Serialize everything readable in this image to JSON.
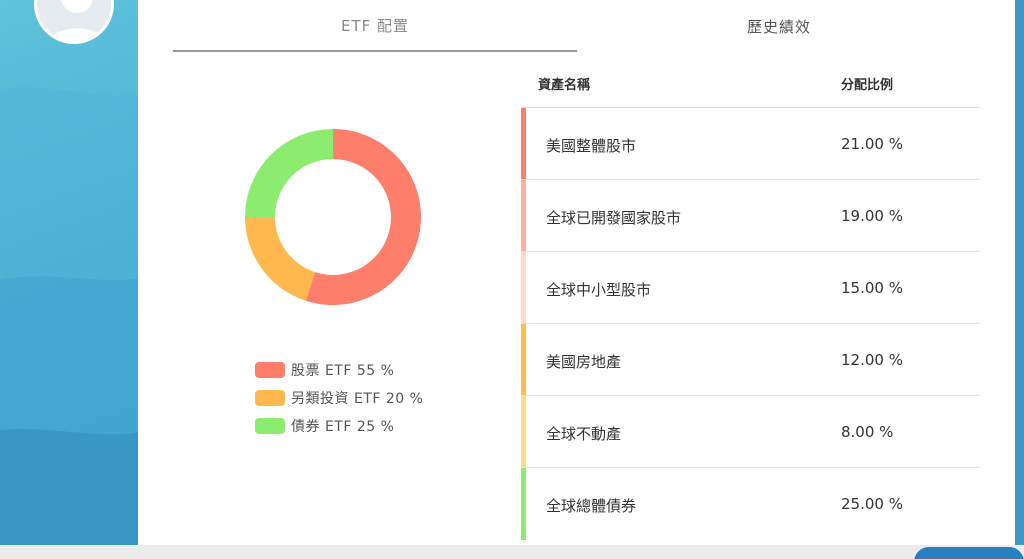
{
  "tabs": [
    {
      "label": "ETF 配置",
      "active": true
    },
    {
      "label": "歷史績效",
      "active": false
    }
  ],
  "chart_data": {
    "type": "pie",
    "variant": "donut",
    "categories": [
      "股票 ETF",
      "另類投資 ETF",
      "債券 ETF"
    ],
    "values": [
      55,
      20,
      25
    ],
    "colors": [
      "#fc7e6b",
      "#ffb84d",
      "#8cec6f"
    ]
  },
  "legend": [
    {
      "label": "股票 ETF 55 %",
      "color": "#fc7e6b"
    },
    {
      "label": "另類投資 ETF 20 %",
      "color": "#ffb84d"
    },
    {
      "label": "債券 ETF 25 %",
      "color": "#8cec6f"
    }
  ],
  "table": {
    "headers": {
      "name": "資產名稱",
      "ratio": "分配比例"
    },
    "rows": [
      {
        "name": "美國整體股市",
        "ratio": "21.00 %",
        "color": "#fc7e6b"
      },
      {
        "name": "全球已開發國家股市",
        "ratio": "19.00 %",
        "color": "#fdb0a4"
      },
      {
        "name": "全球中小型股市",
        "ratio": "15.00 %",
        "color": "#ffd9d2"
      },
      {
        "name": "美國房地產",
        "ratio": "12.00 %",
        "color": "#ffbb4d"
      },
      {
        "name": "全球不動產",
        "ratio": "8.00 %",
        "color": "#ffd98a"
      },
      {
        "name": "全球總體債券",
        "ratio": "25.00 %",
        "color": "#8cec6f"
      }
    ]
  },
  "icons": {
    "avatar": "user-avatar-icon"
  }
}
